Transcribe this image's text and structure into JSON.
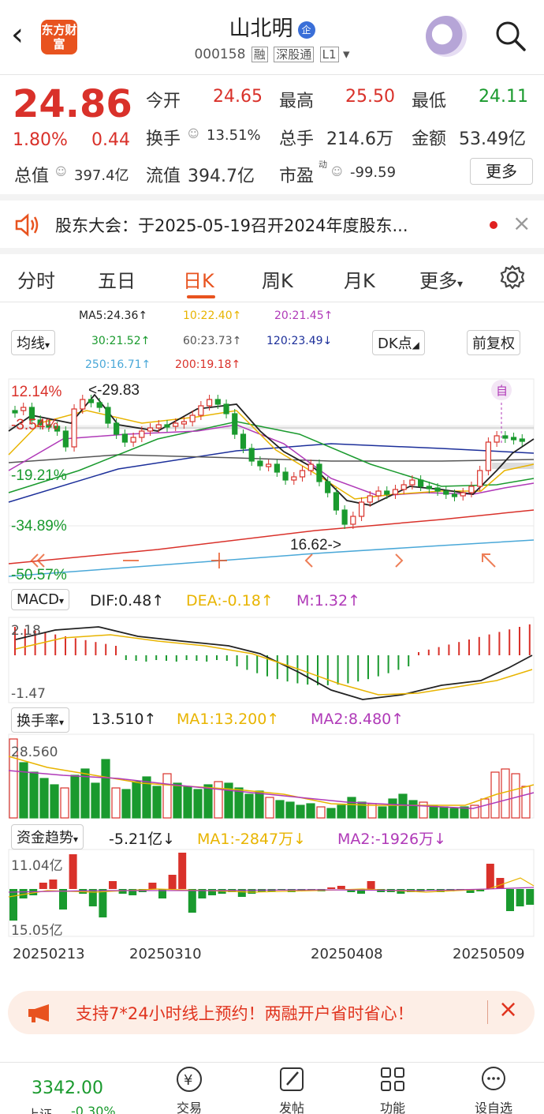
{
  "header": {
    "logo": "东方财富",
    "title": "山北明",
    "code": "000158",
    "tags": [
      "融",
      "深股通",
      "L1"
    ]
  },
  "quote": {
    "price": "24.86",
    "change_pct": "1.80%",
    "change": "0.44",
    "open_label": "今开",
    "open": "24.65",
    "high_label": "最高",
    "high": "25.50",
    "low_label": "最低",
    "low": "24.11",
    "turnover_label": "换手",
    "turnover": "13.51%",
    "vol_label": "总手",
    "vol": "214.6万",
    "amount_label": "金额",
    "amount": "53.49亿",
    "mktcap_label": "总值",
    "mktcap": "397.4亿",
    "float_label": "流值",
    "float": "394.7亿",
    "pe_label": "市盈",
    "pe_sup": "动",
    "pe": "-99.59",
    "more": "更多"
  },
  "notice": {
    "text": "股东大会：于2025-05-19召开2024年度股东..."
  },
  "tabs": [
    "分时",
    "五日",
    "日K",
    "周K",
    "月K",
    "更多"
  ],
  "ma": {
    "ma5": "MA5:24.36↑",
    "ma10": "10:22.40↑",
    "ma20": "20:21.45↑",
    "ma30": "30:21.52↑",
    "ma60": "60:23.73↑",
    "ma120": "120:23.49↓",
    "ma250": "250:16.71↑",
    "ma200": "200:19.18↑"
  },
  "chart_ctrl": {
    "avg": "均线",
    "dk": "DK点",
    "adjust": "前复权",
    "flag": "自"
  },
  "kline": {
    "pct_labels": [
      "12.14%",
      "-3.54%",
      "-19.21%",
      "-34.89%",
      "-50.57%"
    ],
    "max_label": "<-29.83",
    "min_label": "16.62->"
  },
  "macd": {
    "name": "MACD",
    "dif": "DIF:0.48↑",
    "dea": "DEA:-0.18↑",
    "m": "M:1.32↑",
    "top": "2.18",
    "bottom": "-1.47"
  },
  "turnover_ind": {
    "name": "换手率",
    "val": "13.510↑",
    "ma1": "MA1:13.200↑",
    "ma2": "MA2:8.480↑",
    "top": "28.560"
  },
  "fund": {
    "name": "资金趋势",
    "val": "-5.21亿↓",
    "ma1": "MA1:-2847万↓",
    "ma2": "MA2:-1926万↓",
    "top": "11.04亿",
    "bottom": "15.05亿"
  },
  "dates": [
    "20250213",
    "20250310",
    "20250408",
    "20250509"
  ],
  "promo": {
    "text": "支持7*24小时线上预约！两融开户省时省心！"
  },
  "bottom": {
    "index_val": "3342.00",
    "index_name": "上证",
    "index_chg": "-0.30%",
    "items": [
      "交易",
      "发帖",
      "功能",
      "设自选"
    ]
  },
  "colors": {
    "up": "#d9312a",
    "down": "#1a9a2e",
    "accent": "#e8531f",
    "ma5": "#222222",
    "ma10": "#e8b400",
    "ma20": "#b03ab8",
    "ma60": "#555555",
    "ma120": "#1c2f9a",
    "ma250": "#4aa8d8"
  }
}
